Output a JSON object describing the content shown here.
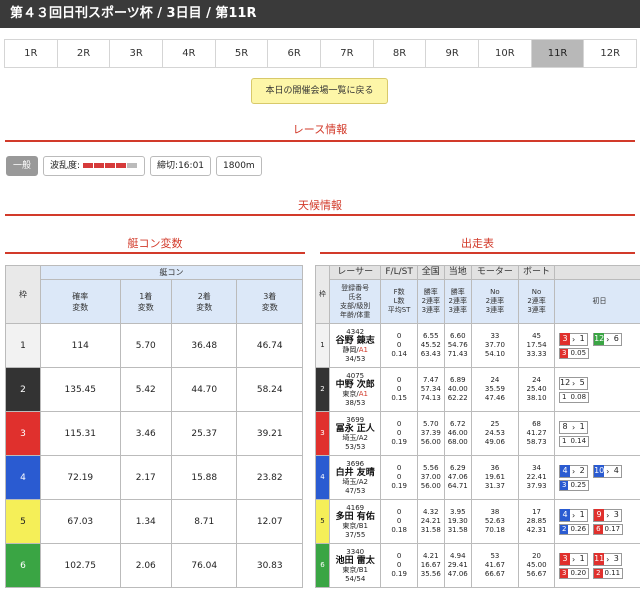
{
  "title": "第４３回日刊スポーツ杯 / 3日目 / 第11R",
  "races": [
    "1R",
    "2R",
    "3R",
    "4R",
    "5R",
    "6R",
    "7R",
    "8R",
    "9R",
    "10R",
    "11R",
    "12R"
  ],
  "active_race": "11R",
  "back_button": "本日の開催会場一覧に戻る",
  "sections": {
    "race_info": "レース情報",
    "weather": "天候情報",
    "kcon": "艇コン変数",
    "entries": "出走表"
  },
  "race_info": {
    "grade": "一般",
    "wave_label": "波乱度:",
    "wave_level": 4,
    "wave_max": 5,
    "deadline": "締切:16:01",
    "distance": "1800m"
  },
  "kcon_table": {
    "waku_header": "枠",
    "group_header": "艇コン",
    "cols": [
      "確率\n変数",
      "1着\n変数",
      "2着\n変数",
      "3着\n変数"
    ],
    "rows": [
      {
        "waku": "1",
        "prob": "114",
        "first": "5.70",
        "second": "36.48",
        "third": "46.74"
      },
      {
        "waku": "2",
        "prob": "135.45",
        "first": "5.42",
        "second": "44.70",
        "third": "58.24"
      },
      {
        "waku": "3",
        "prob": "115.31",
        "first": "3.46",
        "second": "25.37",
        "third": "39.21"
      },
      {
        "waku": "4",
        "prob": "72.19",
        "first": "2.17",
        "second": "15.88",
        "third": "23.82"
      },
      {
        "waku": "5",
        "prob": "67.03",
        "first": "1.34",
        "second": "8.71",
        "third": "12.07"
      },
      {
        "waku": "6",
        "prob": "102.75",
        "first": "2.06",
        "second": "76.04",
        "third": "30.83"
      }
    ]
  },
  "entries_table": {
    "headers": [
      "枠",
      "レーサー",
      "F/L/ST",
      "全国",
      "当地",
      "モーター",
      "ボート",
      ""
    ],
    "subheaders": [
      "登録番号\n氏名\n支部/級別\n年齢/体重",
      "F数\nL数\n平均ST",
      "勝率\n2連率\n3連率",
      "勝率\n2連率\n3連率",
      "No\n2連率\n3連率",
      "No\n2連率\n3連率",
      "初日"
    ],
    "rows": [
      {
        "waku": "1",
        "reg": "4342",
        "name": "谷野 錬志",
        "branch": "静岡/",
        "cls": "A1",
        "age": "34/53",
        "f": "0",
        "l": "0",
        "st": "0.14",
        "nat": [
          "6.55",
          "45.52",
          "63.43"
        ],
        "loc": [
          "6.60",
          "54.76",
          "71.43"
        ],
        "mot": [
          "33",
          "37.70",
          "54.10"
        ],
        "boat": [
          "45",
          "17.54",
          "33.33"
        ],
        "t1": {
          "a": "3",
          "b": "1",
          "sub": [
            "3",
            "0.05"
          ]
        },
        "t2": {
          "a": "12",
          "b": "6",
          "sub": []
        }
      },
      {
        "waku": "2",
        "reg": "4075",
        "name": "中野 次郎",
        "branch": "東京/",
        "cls": "A1",
        "age": "38/53",
        "f": "0",
        "l": "0",
        "st": "0.15",
        "nat": [
          "7.47",
          "57.34",
          "74.13"
        ],
        "loc": [
          "6.89",
          "40.00",
          "62.22"
        ],
        "mot": [
          "24",
          "35.59",
          "47.46"
        ],
        "boat": [
          "24",
          "25.40",
          "38.10"
        ],
        "t1": {
          "a": "12",
          "b": "5",
          "sub": [
            "1",
            "0.08"
          ]
        },
        "t2": null
      },
      {
        "waku": "3",
        "reg": "3699",
        "name": "冨永 正人",
        "branch": "埼玉/A2",
        "cls": "",
        "age": "53/53",
        "f": "0",
        "l": "0",
        "st": "0.19",
        "nat": [
          "5.70",
          "37.39",
          "56.00"
        ],
        "loc": [
          "6.72",
          "46.00",
          "68.00"
        ],
        "mot": [
          "25",
          "24.53",
          "49.06"
        ],
        "boat": [
          "68",
          "41.27",
          "58.73"
        ],
        "t1": {
          "a": "8",
          "b": "1",
          "sub": [
            "1",
            "0.14"
          ]
        },
        "t2": null
      },
      {
        "waku": "4",
        "reg": "3696",
        "name": "白井 友晴",
        "branch": "埼玉/A2",
        "cls": "",
        "age": "47/53",
        "f": "0",
        "l": "0",
        "st": "0.19",
        "nat": [
          "5.56",
          "37.00",
          "56.00"
        ],
        "loc": [
          "6.29",
          "47.06",
          "64.71"
        ],
        "mot": [
          "36",
          "19.61",
          "31.37"
        ],
        "boat": [
          "34",
          "22.41",
          "37.93"
        ],
        "t1": {
          "a": "4",
          "b": "2",
          "sub": [
            "3",
            "0.25"
          ]
        },
        "t2": {
          "a": "10",
          "b": "4",
          "sub": []
        }
      },
      {
        "waku": "5",
        "reg": "4169",
        "name": "多田 有佑",
        "branch": "東京/B1",
        "cls": "",
        "age": "37/55",
        "f": "0",
        "l": "0",
        "st": "0.18",
        "nat": [
          "4.32",
          "24.21",
          "31.58"
        ],
        "loc": [
          "3.95",
          "19.30",
          "31.58"
        ],
        "mot": [
          "38",
          "52.63",
          "70.18"
        ],
        "boat": [
          "17",
          "28.85",
          "42.31"
        ],
        "t1": {
          "a": "4",
          "b": "1",
          "sub": [
            "2",
            "0.26"
          ]
        },
        "t2": {
          "a": "9",
          "b": "3",
          "sub": [
            "6",
            "0.17"
          ]
        }
      },
      {
        "waku": "6",
        "reg": "3340",
        "name": "池田 雷太",
        "branch": "東京/B1",
        "cls": "",
        "age": "54/54",
        "f": "0",
        "l": "0",
        "st": "0.19",
        "nat": [
          "4.21",
          "16.67",
          "35.56"
        ],
        "loc": [
          "4.94",
          "29.41",
          "47.06"
        ],
        "mot": [
          "53",
          "41.67",
          "66.67"
        ],
        "boat": [
          "20",
          "45.00",
          "56.67"
        ],
        "t1": {
          "a": "3",
          "b": "1",
          "sub": [
            "3",
            "0.20"
          ]
        },
        "t2": {
          "a": "11",
          "b": "3",
          "sub": [
            "2",
            "0.11"
          ]
        }
      }
    ]
  },
  "colors": {
    "accent": "#d23a2a",
    "header_blue": "#dce8f8",
    "back_button": "#fdf6a8"
  }
}
